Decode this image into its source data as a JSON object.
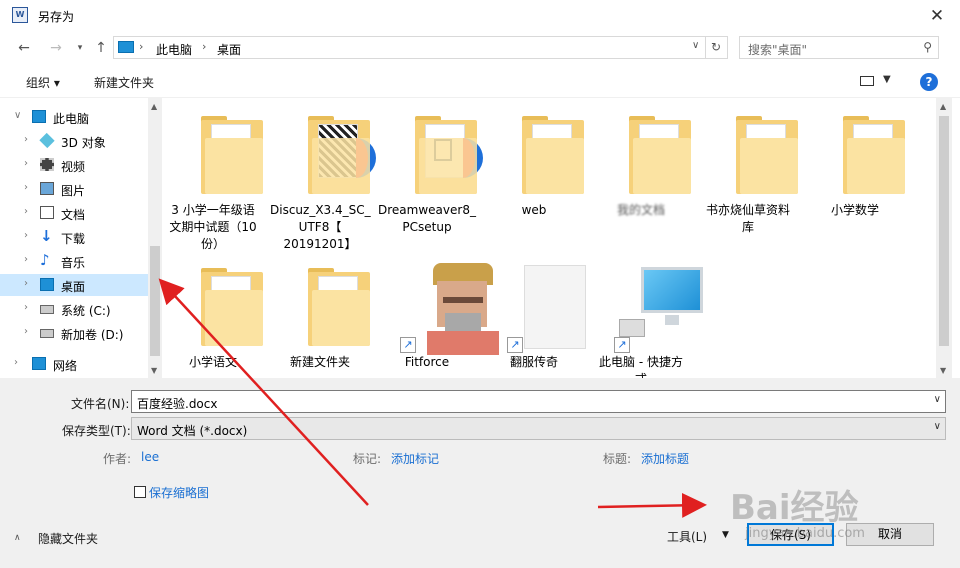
{
  "window": {
    "title": "另存为",
    "app_icon": "W"
  },
  "address": {
    "crumbs": [
      "此电脑",
      "桌面"
    ],
    "search_placeholder": "搜索\"桌面\""
  },
  "toolbar": {
    "organize": "组织",
    "new_folder": "新建文件夹",
    "help": "?"
  },
  "sidebar": {
    "items": [
      {
        "label": "此电脑",
        "icon": "computer-icon"
      },
      {
        "label": "3D 对象",
        "icon": "cube-icon"
      },
      {
        "label": "视频",
        "icon": "video-icon"
      },
      {
        "label": "图片",
        "icon": "picture-icon"
      },
      {
        "label": "文档",
        "icon": "document-icon"
      },
      {
        "label": "下载",
        "icon": "download-icon"
      },
      {
        "label": "音乐",
        "icon": "music-icon"
      },
      {
        "label": "桌面",
        "icon": "desktop-icon"
      },
      {
        "label": "系统 (C:)",
        "icon": "drive-icon"
      },
      {
        "label": "新加卷 (D:)",
        "icon": "drive-icon"
      },
      {
        "label": "网络",
        "icon": "network-icon"
      }
    ]
  },
  "files": [
    {
      "name": "3 小学一年级语文期中试题（10份）",
      "lines": [
        "3 小学一年级语",
        "文期中试题（10",
        "份）"
      ]
    },
    {
      "name": "Discuz_X3.4_SC_UTF8【20191201】",
      "lines": [
        "Discuz_X3.4_SC_",
        "UTF8【",
        "20191201】"
      ]
    },
    {
      "name": "Dreamweaver8_PCsetup",
      "lines": [
        "Dreamweaver8_",
        "PCsetup"
      ]
    },
    {
      "name": "web",
      "lines": [
        "web"
      ]
    },
    {
      "name": "我的文档",
      "lines": [
        "我的文档"
      ]
    },
    {
      "name": "书亦烧仙草资料库",
      "lines": [
        "书亦烧仙草资料",
        "库"
      ]
    },
    {
      "name": "小学数学",
      "lines": [
        "小学数学"
      ]
    },
    {
      "name": "小学语文",
      "lines": [
        "小学语文"
      ]
    },
    {
      "name": "新建文件夹",
      "lines": [
        "新建文件夹"
      ]
    },
    {
      "name": "Fitforce",
      "lines": [
        "Fitforce"
      ]
    },
    {
      "name": "翻服传奇",
      "lines": [
        "翻服传奇"
      ]
    },
    {
      "name": "此电脑 - 快捷方式",
      "lines": [
        "此电脑 - 快捷方",
        "式"
      ]
    }
  ],
  "form": {
    "filename_label": "文件名(N):",
    "filename_value": "百度经验.docx",
    "type_label": "保存类型(T):",
    "type_value": "Word 文档 (*.docx)",
    "author_label": "作者:",
    "author_value": "lee",
    "tags_label": "标记:",
    "tags_value": "添加标记",
    "title_label": "标题:",
    "title_value": "添加标题",
    "thumbnail_label": "保存缩略图",
    "hide_folders": "隐藏文件夹",
    "tools": "工具(L)",
    "save": "保存(S)",
    "cancel": "取消"
  },
  "watermark": {
    "brand": "Bai经验",
    "url": "jingyan.baidu.com"
  },
  "colors": {
    "selected": "#cce8ff",
    "link": "#1a6fd2",
    "accent": "#0078d7",
    "annotation_arrow": "#e02020"
  }
}
